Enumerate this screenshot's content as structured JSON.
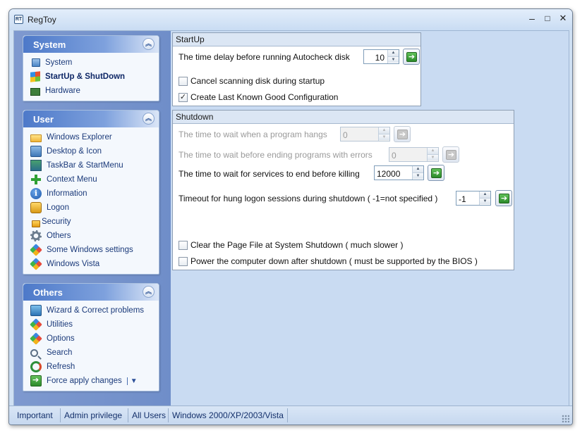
{
  "window": {
    "title": "RegToy",
    "icon_text": "RT"
  },
  "sidebar": {
    "groups": [
      {
        "title": "System",
        "items": [
          {
            "label": "System",
            "icon": "computer-icon"
          },
          {
            "label": "StartUp & ShutDown",
            "icon": "windows-flag-icon",
            "active": true
          },
          {
            "label": "Hardware",
            "icon": "hardware-icon"
          }
        ]
      },
      {
        "title": "User",
        "items": [
          {
            "label": "Windows Explorer",
            "icon": "folder-icon"
          },
          {
            "label": "Desktop & Icon",
            "icon": "desktop-icon"
          },
          {
            "label": "TaskBar & StartMenu",
            "icon": "taskbar-icon"
          },
          {
            "label": "Context Menu",
            "icon": "plus-icon"
          },
          {
            "label": "Information",
            "icon": "info-icon"
          },
          {
            "label": "Logon",
            "icon": "key-icon"
          },
          {
            "label": "Security",
            "icon": "lock-icon"
          },
          {
            "label": "Others",
            "icon": "gear-icon"
          },
          {
            "label": "Some Windows settings",
            "icon": "colorful-icon"
          },
          {
            "label": "Windows Vista",
            "icon": "colorful-icon"
          }
        ]
      },
      {
        "title": "Others",
        "items": [
          {
            "label": "Wizard & Correct problems",
            "icon": "wizard-icon"
          },
          {
            "label": "Utilities",
            "icon": "colorful-icon"
          },
          {
            "label": "Options",
            "icon": "colorful-icon"
          },
          {
            "label": "Search",
            "icon": "search-icon"
          },
          {
            "label": "Refresh",
            "icon": "refresh-icon"
          },
          {
            "label": "Force apply changes",
            "icon": "green-arrow-icon",
            "dropdown": "▼"
          }
        ]
      }
    ],
    "collapse_glyph": "︽"
  },
  "startup": {
    "title": "StartUp",
    "autocheck_label": "The time delay before running Autocheck disk",
    "autocheck_value": "10",
    "cancel_scan_label": "Cancel scanning disk during startup",
    "cancel_scan_checked": false,
    "last_known_label": "Create Last Known Good Configuration",
    "last_known_checked": true
  },
  "shutdown": {
    "title": "Shutdown",
    "hang_label": "The time to wait when a program hangs",
    "hang_value": "0",
    "errors_label": "The time to wait before ending programs with errors",
    "errors_value": "0",
    "services_label": "The time to wait for services to end before killing",
    "services_value": "12000",
    "logon_label": "Timeout for hung logon sessions during shutdown ( -1=not specified )",
    "logon_value": "-1",
    "pagefile_label": "Clear the Page File at System Shutdown ( much slower )",
    "pagefile_checked": false,
    "poweroff_label": "Power the computer down after shutdown ( must be supported by the BIOS )",
    "poweroff_checked": false
  },
  "statusbar": {
    "cells": [
      "Important",
      "Admin privilege",
      "All Users",
      "Windows 2000/XP/2003/Vista"
    ]
  },
  "glyphs": {
    "check": "✓",
    "go": "➔",
    "up": "▲",
    "down": "▼",
    "min": "–",
    "max": "□",
    "close": "✕"
  }
}
